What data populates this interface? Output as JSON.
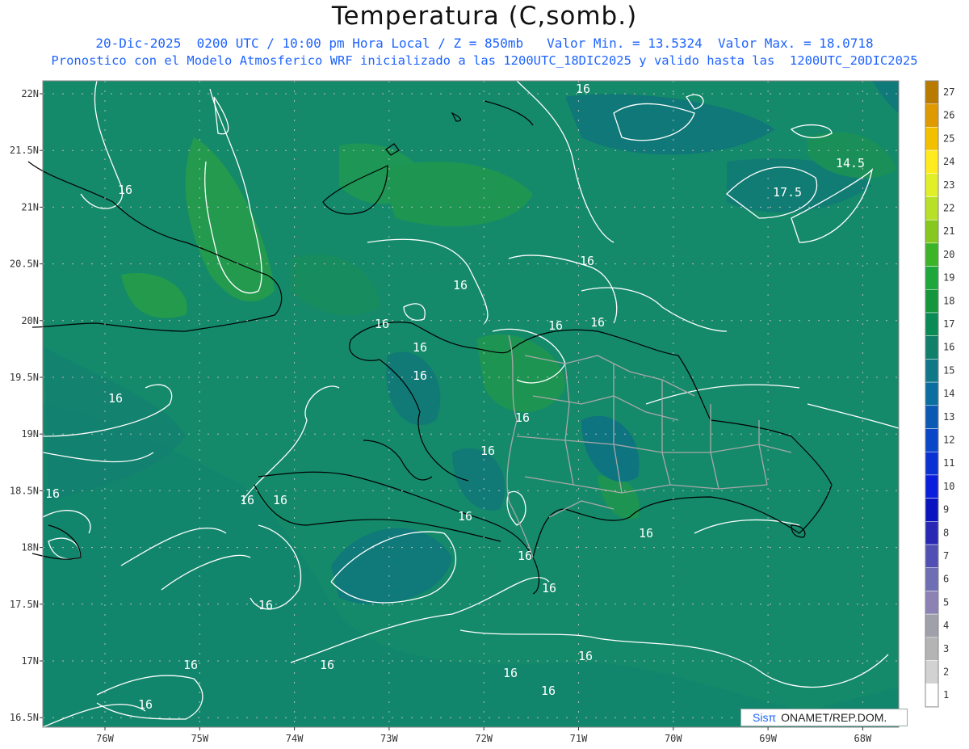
{
  "title": "Temperatura (C,somb.)",
  "header": {
    "line1": "20-Dic-2025  0200 UTC / 10:00 pm Hora Local / Z = 850mb   Valor Min. = 13.5324  Valor Max. = 18.0718",
    "line2": "Pronostico con el Modelo Atmosferico WRF inicializado a las 1200UTC_18DIC2025 y valido hasta las  1200UTC_20DIC2025"
  },
  "axes": {
    "lat_labels": [
      "22N",
      "21.5N",
      "21N",
      "20.5N",
      "20N",
      "19.5N",
      "19N",
      "18.5N",
      "18N",
      "17.5N",
      "17N",
      "16.5N"
    ],
    "lon_labels": [
      "76W",
      "75W",
      "74W",
      "73W",
      "72W",
      "71W",
      "70W",
      "69W",
      "68W"
    ]
  },
  "colorbar": {
    "labels": [
      "27",
      "26",
      "25",
      "24",
      "23",
      "22",
      "21",
      "20",
      "19",
      "18",
      "17",
      "16",
      "15",
      "14",
      "13",
      "12",
      "11",
      "10",
      "9",
      "8",
      "7",
      "6",
      "5",
      "4",
      "3",
      "2",
      "1"
    ],
    "colors": [
      "#b97a00",
      "#de9a00",
      "#f3c000",
      "#ffeb1e",
      "#e0ef28",
      "#b8e028",
      "#86c81e",
      "#3cb428",
      "#1ea83c",
      "#14963c",
      "#0a8a55",
      "#10806a",
      "#0f7887",
      "#0a6ea0",
      "#0a5ab4",
      "#0a46c8",
      "#0a32d2",
      "#0a1edc",
      "#0a14be",
      "#2828b4",
      "#5050b4",
      "#6e6eb4",
      "#8c82b4",
      "#a0a0aa",
      "#b4b4b4",
      "#d2d2d2",
      "#ffffff"
    ]
  },
  "contour_labels": [
    "16",
    "16",
    "16",
    "16",
    "16",
    "16",
    "16",
    "16",
    "16",
    "16",
    "16",
    "16",
    "16",
    "16",
    "16",
    "16",
    "16",
    "16",
    "16",
    "16",
    "16",
    "16",
    "16",
    "16",
    "16",
    "16",
    "14.5",
    "17.5"
  ],
  "credit": {
    "sis": "Sisπ",
    "org": "ONAMET/REP.DOM."
  },
  "colors": {
    "header_text": "#1e64ff",
    "contour": "#ffffff",
    "coast": "#000000",
    "border": "#a0a0a0"
  }
}
